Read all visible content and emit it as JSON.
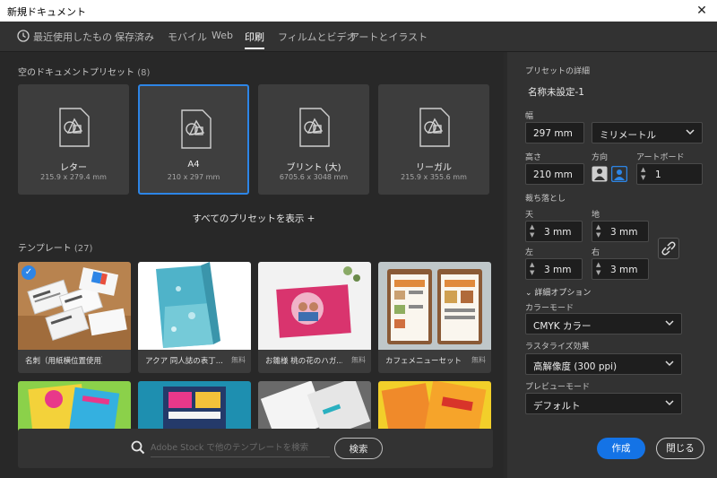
{
  "window": {
    "title": "新規ドキュメント",
    "close_glyph": "✕"
  },
  "tabs": [
    {
      "label": "最近使用したもの"
    },
    {
      "label": "保存済み"
    },
    {
      "label": "モバイル"
    },
    {
      "label": "Web"
    },
    {
      "label": "印刷"
    },
    {
      "label": "フィルムとビデオ"
    },
    {
      "label": "アートとイラスト"
    }
  ],
  "presets": {
    "label": "空のドキュメントプリセット",
    "count": "(8)",
    "items": [
      {
        "name": "レター",
        "size": "215.9 x 279.4 mm"
      },
      {
        "name": "A4",
        "size": "210 x 297 mm"
      },
      {
        "name": "ブリント (大)",
        "size": "6705.6 x 3048 mm"
      },
      {
        "name": "リーガル",
        "size": "215.9 x 355.6 mm"
      }
    ],
    "show_all": "すべてのプリセットを表示 +"
  },
  "templates": {
    "label": "テンプレート",
    "count": "(27)",
    "items": [
      {
        "name": "名刺（用紙横位置使用）",
        "free": ""
      },
      {
        "name": "アクア 同人誌の表丁...",
        "free": "無料"
      },
      {
        "name": "お雛様 桃の花のハガ...",
        "free": "無料"
      },
      {
        "name": "カフェメニューセット",
        "free": "無料"
      }
    ]
  },
  "search": {
    "placeholder": "Adobe Stock で他のテンプレートを検索",
    "button": "検索"
  },
  "details": {
    "header": "プリセットの詳細",
    "doc_name": "名称未設定-1",
    "width_label": "幅",
    "width_value": "297 mm",
    "unit_value": "ミリメートル",
    "height_label": "高さ",
    "height_value": "210 mm",
    "orientation_label": "方向",
    "artboard_label": "アートボード",
    "artboard_value": "1",
    "bleed_label": "裁ち落とし",
    "top_label": "天",
    "top_value": "3 mm",
    "bottom_label": "地",
    "bottom_value": "3 mm",
    "left_label": "左",
    "left_value": "3 mm",
    "right_label": "右",
    "right_value": "3 mm",
    "advanced_label": "詳細オプション",
    "color_mode_label": "カラーモード",
    "color_mode_value": "CMYK カラー",
    "raster_label": "ラスタライズ効果",
    "raster_value": "高解像度 (300 ppi)",
    "preview_label": "プレビューモード",
    "preview_value": "デフォルト"
  },
  "footer": {
    "create": "作成",
    "close": "閉じる"
  },
  "colors": {
    "accent": "#1473e6",
    "selected_border": "#2d85e6"
  }
}
